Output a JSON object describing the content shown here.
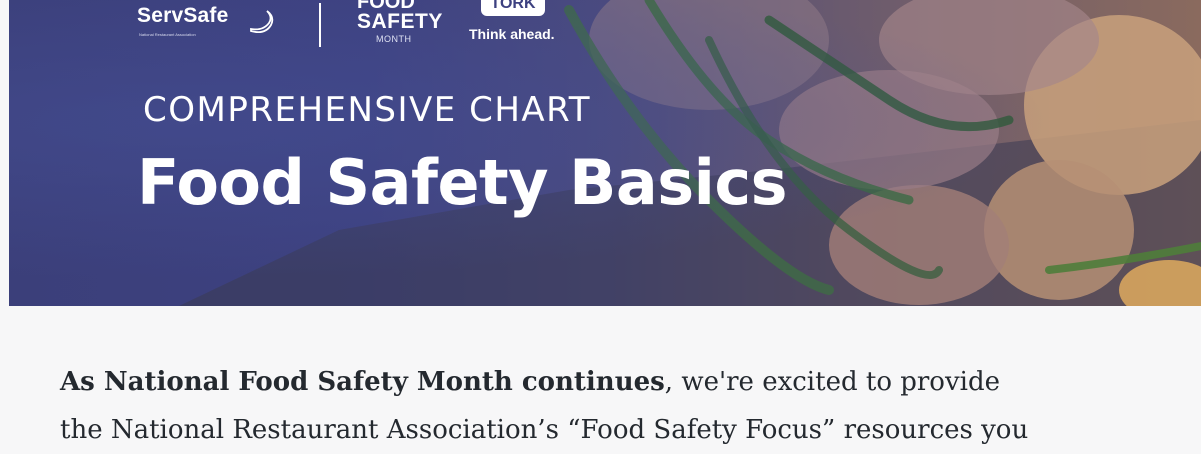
{
  "banner": {
    "logos": {
      "servsafe": {
        "name": "ServSafe",
        "subtitle": "National Restaurant Association"
      },
      "food_safety_month": {
        "top": "FOOD",
        "safety": "SAFETY",
        "month": "MONTH"
      },
      "tork": {
        "badge": "TORK",
        "tagline": "Think ahead."
      }
    },
    "eyebrow": "COMPREHENSIVE CHART",
    "title": "Food Safety Basics"
  },
  "article": {
    "lead_bold": "As National Food Safety Month continues",
    "lead_rest": ", we're excited to provide",
    "line2": "the National Restaurant Association’s “Food Safety Focus” resources you"
  },
  "colors": {
    "banner_overlay": "#3d4180",
    "text_body": "#24292f",
    "page_background": "#f7f7f8"
  }
}
